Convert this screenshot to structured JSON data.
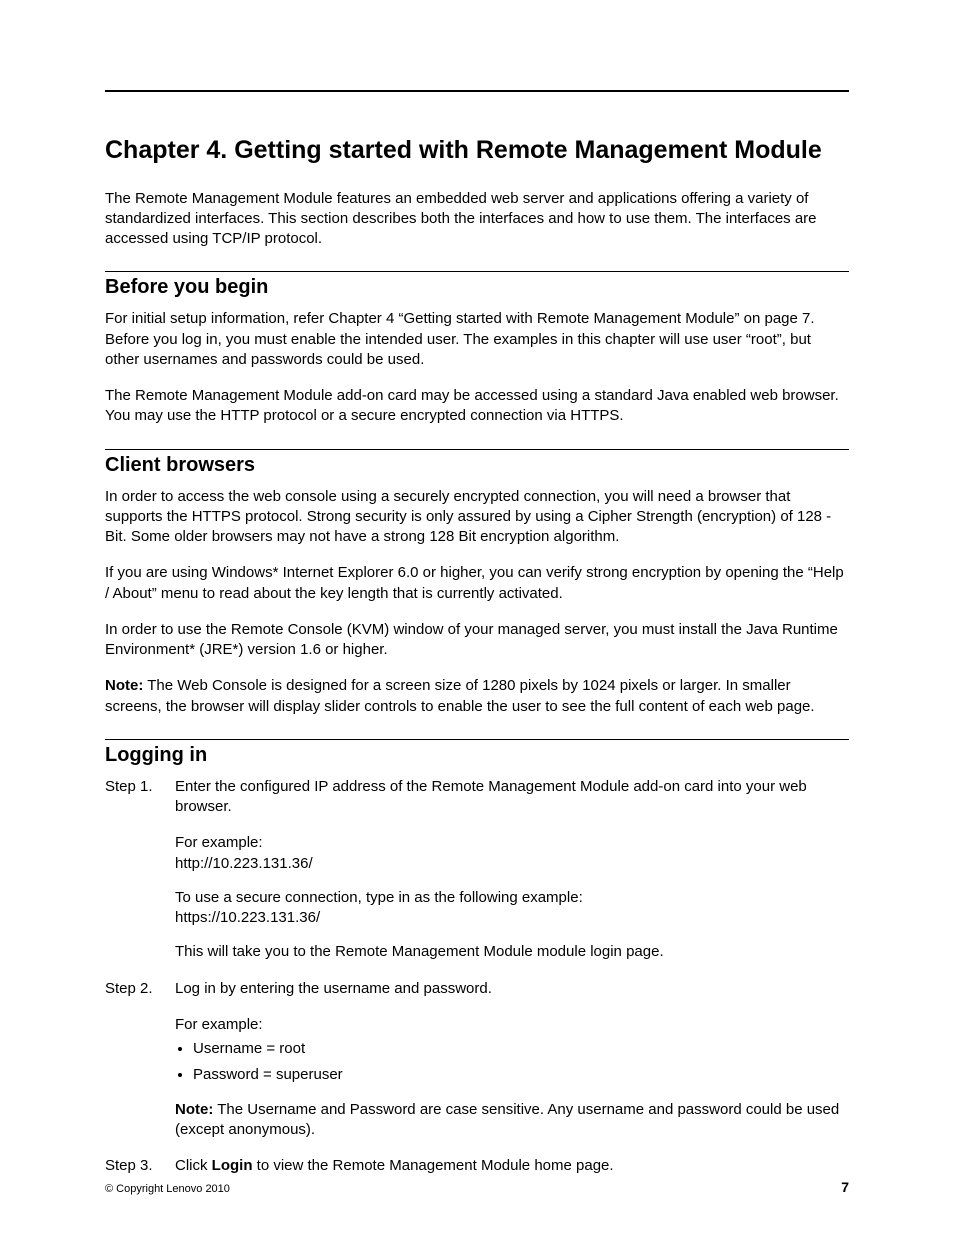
{
  "chapter": {
    "title": "Chapter 4.   Getting started with Remote Management Module",
    "intro": "The Remote Management Module features an embedded web server and applications offering a variety of standardized interfaces. This section describes both the interfaces and how to use them. The interfaces are accessed using TCP/IP protocol."
  },
  "sections": {
    "before": {
      "title": "Before you begin",
      "p1": "For initial setup information, refer Chapter 4 “Getting started with Remote Management Module” on page 7. Before you log in, you must enable the intended user. The examples in this chapter will use user “root”, but other usernames and passwords could be used.",
      "p2": "The Remote Management Module add-on card may be accessed using a standard Java enabled web browser. You may use the HTTP protocol or a secure encrypted connection via HTTPS."
    },
    "client": {
      "title": "Client browsers",
      "p1": "In order to access the web console using a securely encrypted connection, you will need a browser that supports the HTTPS protocol. Strong security is only assured by using a Cipher Strength (encryption) of 128 - Bit. Some older browsers may not have a strong 128 Bit encryption algorithm.",
      "p2": "If you are using Windows* Internet Explorer 6.0 or higher, you can verify strong encryption by opening the “Help / About” menu to read about the key length that is currently activated.",
      "p3": "In order to use the Remote Console (KVM) window of your managed server, you must install the Java Runtime Environment* (JRE*) version 1.6 or higher.",
      "note_label": "Note:",
      "note_body": " The Web Console is designed for a screen size of 1280 pixels by 1024 pixels or larger. In smaller screens, the browser will display slider controls to enable the user to see the full content of each web page."
    },
    "logging": {
      "title": "Logging in",
      "step1": {
        "label": "Step 1.",
        "line1": "Enter the configured IP address of the Remote Management Module add-on card into your web browser.",
        "example_label": "For example:",
        "example_url": "http://10.223.131.36/",
        "secure_label": "To use a secure connection, type in as the following example:",
        "secure_url": "https://10.223.131.36/",
        "tail": "This will take you to the Remote Management Module module login page."
      },
      "step2": {
        "label": "Step 2.",
        "line1": "Log in by entering the username and password.",
        "example_label": "For example:",
        "bullet1": "Username = root",
        "bullet2": "Password = superuser",
        "note_label": "Note:",
        "note_body": " The Username and Password are case sensitive. Any username and password could be used (except anonymous)."
      },
      "step3": {
        "label": "Step 3.",
        "pre": "Click ",
        "bold": "Login",
        "post": " to view the Remote Management Module home page."
      }
    }
  },
  "footer": {
    "copyright": "© Copyright Lenovo 2010",
    "page_number": "7"
  }
}
